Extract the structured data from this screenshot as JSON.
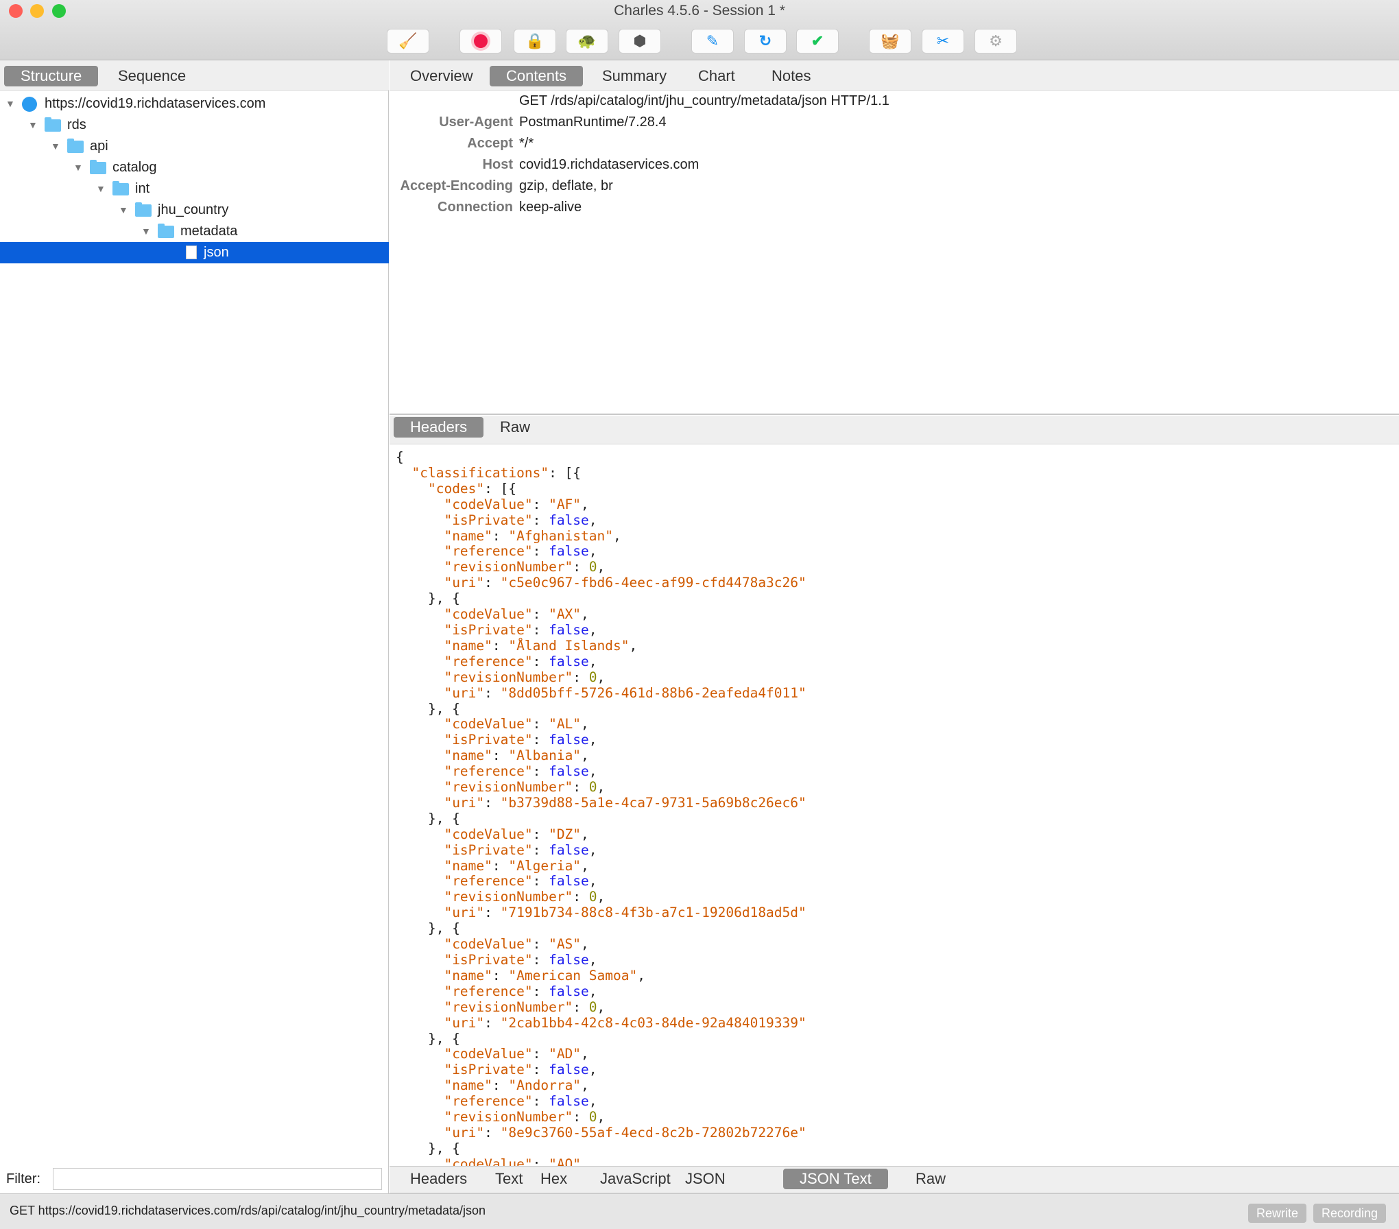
{
  "window": {
    "title": "Charles 4.5.6 - Session 1 *"
  },
  "toolbar": [
    "broom-icon",
    "record-icon",
    "ssl-lock-icon",
    "throttle-turtle-icon",
    "breakpoint-hexagon-icon",
    "compose-pen-icon",
    "repeat-icon",
    "validate-check-icon",
    "basket-icon",
    "tools-icon",
    "settings-gear-icon"
  ],
  "left_tabs": [
    "Structure",
    "Sequence"
  ],
  "tree": [
    {
      "label": "https://covid19.richdataservices.com",
      "depth": 0,
      "type": "host"
    },
    {
      "label": "rds",
      "depth": 1,
      "type": "folder"
    },
    {
      "label": "api",
      "depth": 2,
      "type": "folder"
    },
    {
      "label": "catalog",
      "depth": 3,
      "type": "folder"
    },
    {
      "label": "int",
      "depth": 4,
      "type": "folder"
    },
    {
      "label": "jhu_country",
      "depth": 5,
      "type": "folder"
    },
    {
      "label": "metadata",
      "depth": 6,
      "type": "folder"
    },
    {
      "label": "json",
      "depth": 7,
      "type": "file",
      "selected": true
    }
  ],
  "filter": {
    "label": "Filter:",
    "value": ""
  },
  "right_tabs": [
    "Overview",
    "Contents",
    "Summary",
    "Chart",
    "Notes"
  ],
  "request": {
    "line": "GET /rds/api/catalog/int/jhu_country/metadata/json HTTP/1.1",
    "headers": [
      [
        "User-Agent",
        "PostmanRuntime/7.28.4"
      ],
      [
        "Accept",
        "*/*"
      ],
      [
        "Host",
        "covid19.richdataservices.com"
      ],
      [
        "Accept-Encoding",
        "gzip, deflate, br"
      ],
      [
        "Connection",
        "keep-alive"
      ]
    ]
  },
  "request_tabs": [
    "Headers",
    "Raw"
  ],
  "response_lines": [
    "{",
    "  \"classifications\": [{",
    "    \"codes\": [{",
    "      \"codeValue\": \"AF\",",
    "      \"isPrivate\": false,",
    "      \"name\": \"Afghanistan\",",
    "      \"reference\": false,",
    "      \"revisionNumber\": 0,",
    "      \"uri\": \"c5e0c967-fbd6-4eec-af99-cfd4478a3c26\"",
    "    }, {",
    "      \"codeValue\": \"AX\",",
    "      \"isPrivate\": false,",
    "      \"name\": \"Åland Islands\",",
    "      \"reference\": false,",
    "      \"revisionNumber\": 0,",
    "      \"uri\": \"8dd05bff-5726-461d-88b6-2eafeda4f011\"",
    "    }, {",
    "      \"codeValue\": \"AL\",",
    "      \"isPrivate\": false,",
    "      \"name\": \"Albania\",",
    "      \"reference\": false,",
    "      \"revisionNumber\": 0,",
    "      \"uri\": \"b3739d88-5a1e-4ca7-9731-5a69b8c26ec6\"",
    "    }, {",
    "      \"codeValue\": \"DZ\",",
    "      \"isPrivate\": false,",
    "      \"name\": \"Algeria\",",
    "      \"reference\": false,",
    "      \"revisionNumber\": 0,",
    "      \"uri\": \"7191b734-88c8-4f3b-a7c1-19206d18ad5d\"",
    "    }, {",
    "      \"codeValue\": \"AS\",",
    "      \"isPrivate\": false,",
    "      \"name\": \"American Samoa\",",
    "      \"reference\": false,",
    "      \"revisionNumber\": 0,",
    "      \"uri\": \"2cab1bb4-42c8-4c03-84de-92a484019339\"",
    "    }, {",
    "      \"codeValue\": \"AD\",",
    "      \"isPrivate\": false,",
    "      \"name\": \"Andorra\",",
    "      \"reference\": false,",
    "      \"revisionNumber\": 0,",
    "      \"uri\": \"8e9c3760-55af-4ecd-8c2b-72802b72276e\"",
    "    }, {",
    "      \"codeValue\": \"AO\","
  ],
  "response_tabs": [
    "Headers",
    "Text",
    "Hex",
    "JavaScript",
    "JSON",
    "JSON Text",
    "Raw"
  ],
  "status": {
    "text": "GET https://covid19.richdataservices.com/rds/api/catalog/int/jhu_country/metadata/json",
    "rewrite": "Rewrite",
    "recording": "Recording"
  },
  "colors": {
    "selection": "#0a5fdb",
    "json_string": "#d05a00",
    "json_boolean": "#2222ee",
    "json_number": "#8a8a00"
  }
}
